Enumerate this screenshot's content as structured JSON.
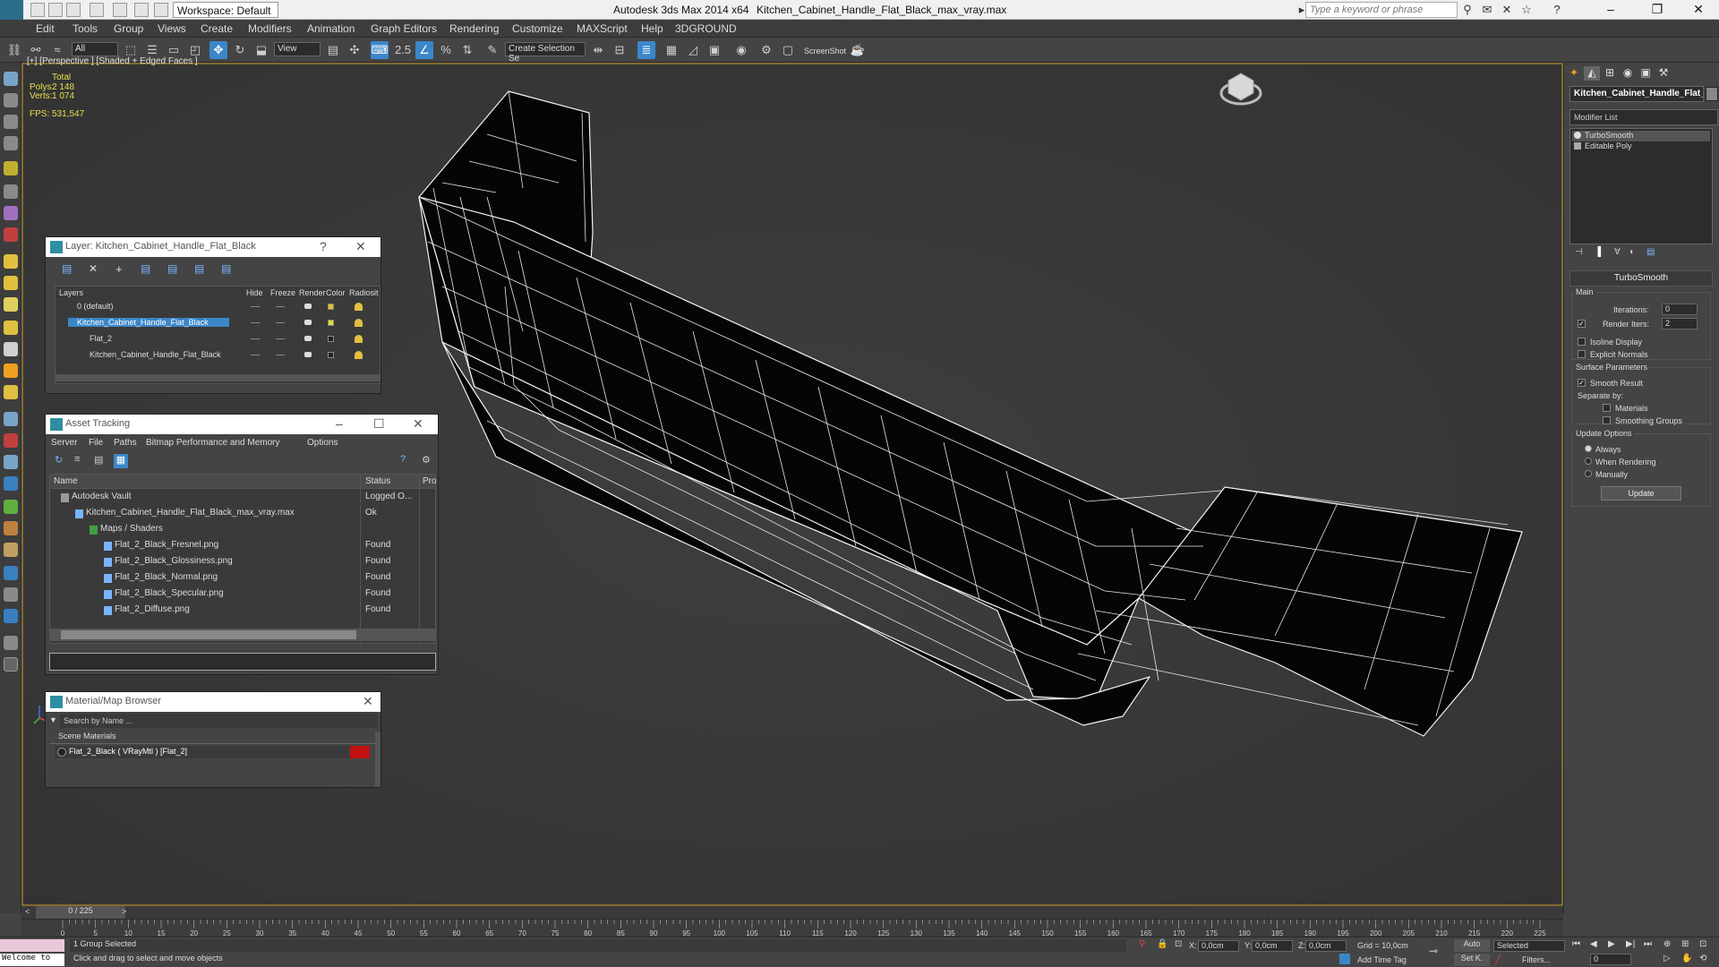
{
  "titlebar": {
    "workspace": "Workspace: Default",
    "app_title": "Autodesk 3ds Max  2014 x64",
    "file_title": "Kitchen_Cabinet_Handle_Flat_Black_max_vray.max",
    "search_placeholder": "Type a keyword or phrase"
  },
  "menubar": [
    "Edit",
    "Tools",
    "Group",
    "Views",
    "Create",
    "Modifiers",
    "Animation",
    "Graph Editors",
    "Rendering",
    "Customize",
    "MAXScript",
    "Help",
    "3DGROUND"
  ],
  "toolbar": {
    "selection_filter": "All",
    "ref_coord": "View",
    "named_selection": "Create Selection Se",
    "screenshot_label": "ScreenShot"
  },
  "viewport": {
    "label": "[+] [Perspective ] [Shaded + Edged Faces ]",
    "stats_total": "Total",
    "polys_label": "Polys:",
    "polys_value": "2 148",
    "verts_label": "Verts:",
    "verts_value": "1 074",
    "fps_label": "FPS:",
    "fps_value": "531,547"
  },
  "layer_dialog": {
    "title": "Layer: Kitchen_Cabinet_Handle_Flat_Black",
    "help": "?",
    "columns": [
      "Layers",
      "Hide",
      "Freeze",
      "Render",
      "Color",
      "Radiosit"
    ],
    "rows": [
      {
        "name": "0 (default)",
        "indent": 0,
        "color": "#e0c020",
        "selected": false
      },
      {
        "name": "Kitchen_Cabinet_Handle_Flat_Black",
        "indent": 0,
        "color": "#e0e020",
        "selected": true
      },
      {
        "name": "Flat_2",
        "indent": 1,
        "color": "#222222",
        "selected": false
      },
      {
        "name": "Kitchen_Cabinet_Handle_Flat_Black",
        "indent": 1,
        "color": "#222222",
        "selected": false
      }
    ]
  },
  "asset_dialog": {
    "title": "Asset Tracking",
    "menu": [
      "Server",
      "File",
      "Paths",
      "Bitmap Performance and Memory",
      "Options"
    ],
    "columns": [
      "Name",
      "Status",
      "Pro"
    ],
    "rows": [
      {
        "name": "Autodesk Vault",
        "status": "Logged O...",
        "indent": 1
      },
      {
        "name": "Kitchen_Cabinet_Handle_Flat_Black_max_vray.max",
        "status": "Ok",
        "indent": 2
      },
      {
        "name": "Maps / Shaders",
        "status": "",
        "indent": 3
      },
      {
        "name": "Flat_2_Black_Fresnel.png",
        "status": "Found",
        "indent": 4
      },
      {
        "name": "Flat_2_Black_Glossiness.png",
        "status": "Found",
        "indent": 4
      },
      {
        "name": "Flat_2_Black_Normal.png",
        "status": "Found",
        "indent": 4
      },
      {
        "name": "Flat_2_Black_Specular.png",
        "status": "Found",
        "indent": 4
      },
      {
        "name": "Flat_2_Diffuse.png",
        "status": "Found",
        "indent": 4
      }
    ]
  },
  "material_browser": {
    "title": "Material/Map Browser",
    "search_placeholder": "Search by Name ...",
    "section": "Scene Materials",
    "item": "Flat_2_Black  ( VRayMtl )  [Flat_2]"
  },
  "command_panel": {
    "object_name": "Kitchen_Cabinet_Handle_Flat_Bla",
    "modifier_list": "Modifier List",
    "stack": [
      "TurboSmooth",
      "Editable Poly"
    ],
    "rollout_title": "TurboSmooth",
    "main_label": "Main",
    "iterations_label": "Iterations:",
    "iterations_value": "0",
    "render_iters_label": "Render Iters:",
    "render_iters_value": "2",
    "isoline_label": "Isoline Display",
    "explicit_normals_label": "Explicit Normals",
    "surface_params_label": "Surface Parameters",
    "smooth_result_label": "Smooth Result",
    "separate_by_label": "Separate by:",
    "materials_label": "Materials",
    "smoothing_groups_label": "Smoothing Groups",
    "update_options_label": "Update Options",
    "always_label": "Always",
    "when_rendering_label": "When Rendering",
    "manually_label": "Manually",
    "update_button": "Update"
  },
  "timeline": {
    "frame_counter": "0 / 225",
    "ticks": [
      "0",
      "5",
      "10",
      "15",
      "20",
      "25",
      "30",
      "35",
      "40",
      "45",
      "50",
      "55",
      "60",
      "65",
      "70",
      "75",
      "80",
      "85",
      "90",
      "95",
      "100",
      "105",
      "110",
      "115",
      "120",
      "125",
      "130",
      "135",
      "140",
      "145",
      "150",
      "155",
      "160",
      "165",
      "170",
      "175",
      "180",
      "185",
      "190",
      "195",
      "200",
      "205",
      "210",
      "215",
      "220",
      "225"
    ]
  },
  "statusbar": {
    "maxscript": "Welcome to",
    "selection": "1 Group Selected",
    "prompt": "Click and drag to select and move objects",
    "x_value": "0,0cm",
    "y_value": "0,0cm",
    "z_value": "0,0cm",
    "grid": "Grid = 10,0cm",
    "add_time_tag": "Add Time Tag",
    "auto": "Auto",
    "set_key": "Set K.",
    "selected_dropdown": "Selected",
    "filters": "Filters...",
    "frame_value": "0"
  }
}
